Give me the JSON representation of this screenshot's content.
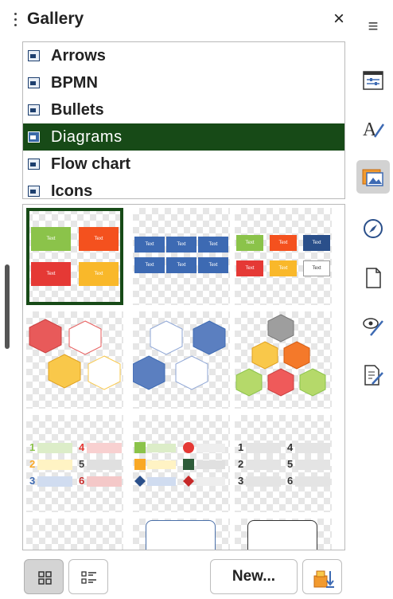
{
  "panel": {
    "title": "Gallery",
    "close_label": "×"
  },
  "themes": [
    {
      "label": "Arrows",
      "selected": false
    },
    {
      "label": "BPMN",
      "selected": false
    },
    {
      "label": "Bullets",
      "selected": false
    },
    {
      "label": "Diagrams",
      "selected": true
    },
    {
      "label": "Flow chart",
      "selected": false
    },
    {
      "label": "Icons",
      "selected": false
    }
  ],
  "thumbnails": {
    "box_text": "Text",
    "selected_index": 0
  },
  "bottom": {
    "new_label": "New..."
  },
  "sidebar": {
    "menu_label": "≡"
  },
  "colors": {
    "selection": "#174a17",
    "green": "#8bc34a",
    "orange": "#f4511e",
    "red": "#e53935",
    "yellow": "#f9b82a",
    "blue": "#3d6ab3"
  }
}
